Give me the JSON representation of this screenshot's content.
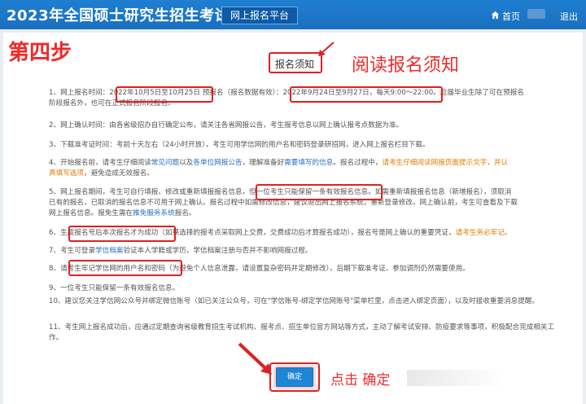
{
  "header": {
    "title": "2023年全国硕士研究生招生考试",
    "platform": "网上报名平台",
    "home": "首页",
    "logout": "退出"
  },
  "annotations": {
    "step": "第四步",
    "read": "阅读报名须知",
    "click": "点击 确定"
  },
  "notice": {
    "title": "报名须知",
    "items": [
      {
        "n": "1、",
        "parts": [
          "网上报名时间：",
          "2022年10月5日至10月25日",
          "预报名（报名数据有效）：",
          "2022年9月24日至9月27日，每天9:00～22:00。",
          "应届毕业生除了可在预报名",
          "阶段报名外，也可在正式报名阶段报名。"
        ]
      },
      {
        "n": "2、",
        "text": "网上确认时间：由各省级招办自行确定公布，请关注各省网报公告，考生报考信息以网上确认报考点数据为准。"
      },
      {
        "n": "3、",
        "text": "下载准考证时间：考前十天左右（24小时开放），考生可用学信网的用户名和密码登录研招网，进入网上报名栏目下载。"
      },
      {
        "n": "4、",
        "parts": [
          "开始报名前，请考生仔细阅读",
          "常见问题",
          "以及",
          "各单位网报公告",
          "，理解准备好",
          "需要填写的信息",
          "。报名过程中，",
          "请考生仔细阅读网报页面提示文字，并认",
          "真填写选项",
          "，避免造成无效报名。"
        ]
      },
      {
        "n": "5、",
        "parts": [
          "网上报名期间，考生可自行填报、修改或重新填报报名信息，",
          "但一位考生只能保留一条有效报名信息。",
          "如需重新填报报名信息（新增报名），须取消",
          "已有的报名，已取消的报名信息不可用于网上确认。报名过程中如需修改信息，建议退出网上报名系统，重新登录修改。网上确认前，考生可查看及下载",
          "网上报名信息。报免生需在",
          "推免服务系统",
          "报名。"
        ]
      },
      {
        "n": "6、",
        "parts": [
          "生成报名号后本次报名才为成功",
          "（如果选择的报考点采取网上交费，交费成功后才算报名成功），报名号是网上确认的重要凭证，",
          "请考生务必牢记。"
        ]
      },
      {
        "n": "7、",
        "parts": [
          "考生可登录",
          "学信档案",
          "验证本人学籍或学历，学信档案注册与否并不影响网报过程。"
        ]
      },
      {
        "n": "8、",
        "parts": [
          "请考生牢记学信网的用户名和密码",
          "（为避免个人信息泄露，请设置复杂密码并定期修改），后期下载准考证、参加调剂仍然需要使用。"
        ]
      },
      {
        "n": "9、",
        "text": "一位考生只能保留一条有效报名信息。"
      },
      {
        "n": "10、",
        "text": "建议您关注学信网公众号并绑定微信账号（如已关注公众号，可在\"学信账号-绑定学信网账号\"菜单栏里，点击进入绑定页面），以及时接收重要消息提醒。"
      },
      {
        "n": "11、",
        "text": "考生网上报名成功后，应通过定期查询省级教育招生考试机构、报考点、招生单位官方网站等方式，主动了解考试安排、防疫要求等事项，积极配合完成相关工作。"
      }
    ],
    "confirm_label": "确定"
  },
  "colors": {
    "header_blue": "#1a6fc0",
    "annotation_red": "#ef2a2a",
    "link_blue": "#2a6fc2",
    "warn_orange": "#e07b00",
    "button_blue": "#1e86d6"
  },
  "icons": {
    "home": "home-icon"
  }
}
